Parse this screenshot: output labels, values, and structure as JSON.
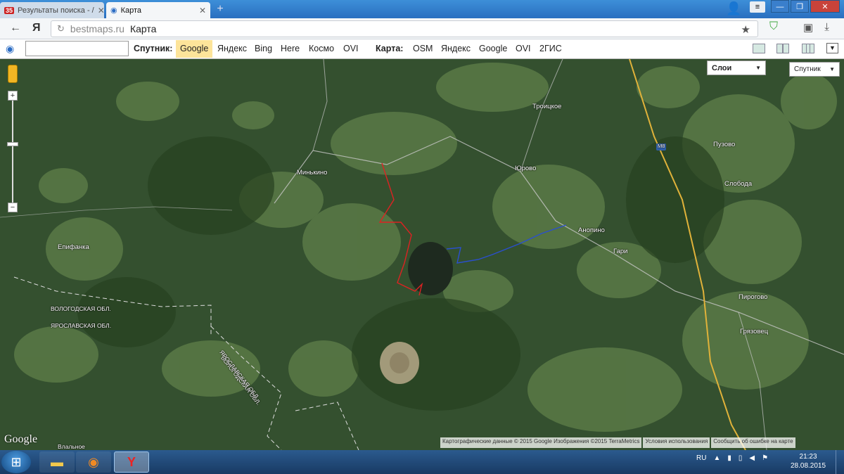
{
  "browser": {
    "tabs": [
      {
        "badge": "35",
        "label": "Результаты поиска - /"
      },
      {
        "label": "Карта"
      }
    ],
    "address": {
      "host": "bestmaps.ru",
      "title": "Карта"
    }
  },
  "toolbar": {
    "search_value": "",
    "satellite_label": "Спутник:",
    "satellite_options": [
      "Google",
      "Яндекс",
      "Bing",
      "Here",
      "Космо",
      "OVI"
    ],
    "satellite_selected": "Google",
    "map_label": "Карта:",
    "map_options": [
      "OSM",
      "Яндекс",
      "Google",
      "OVI",
      "2ГИС"
    ]
  },
  "map": {
    "layers_label": "Слои",
    "type_label": "Спутник",
    "road_badge": "M8",
    "places": [
      "Троицкое",
      "Пузово",
      "Юрово",
      "Минькино",
      "Слобода",
      "Анопино",
      "Гари",
      "Епифанка",
      "Пирогово",
      "Грязовец",
      "Влальное"
    ],
    "regions": [
      "ВОЛОГОДСКАЯ ОБЛ.",
      "ЯРОСЛАВСКАЯ ОБЛ.",
      "ВОЛОГОДСКАЯ ОБЛ.",
      "ЯРОСЛАВСКАЯ ОБЛ."
    ],
    "logo": "Google",
    "copyright": [
      "Картографические данные © 2015 Google Изображения ©2015 TerraMetrics",
      "Условия использования",
      "Сообщить об ошибке на карте"
    ]
  },
  "taskbar": {
    "lang": "RU",
    "time": "21:23",
    "date": "28.08.2015"
  }
}
